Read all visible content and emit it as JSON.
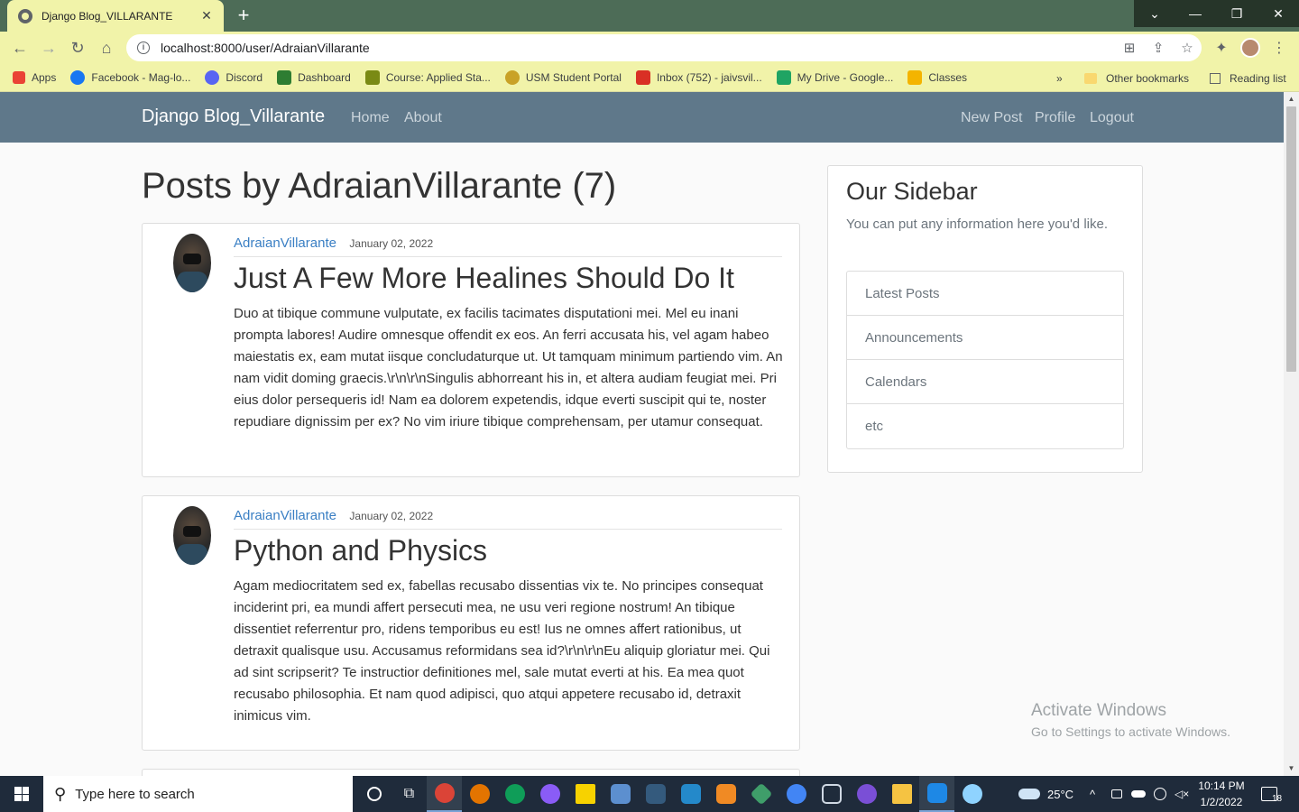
{
  "browser": {
    "tab_title": "Django Blog_VILLARANTE",
    "tab_close": "✕",
    "new_tab": "+",
    "url": "localhost:8000/user/AdraianVillarante",
    "window_buttons": [
      "⌄",
      "—",
      "❐",
      "✕"
    ]
  },
  "bookmarks": {
    "items": [
      {
        "label": "Apps",
        "color": "#ea4335"
      },
      {
        "label": "Facebook - Mag-lo...",
        "color": "#1877f2"
      },
      {
        "label": "Discord",
        "color": "#5865f2"
      },
      {
        "label": "Dashboard",
        "color": "#2e7d32"
      },
      {
        "label": "Course: Applied Sta...",
        "color": "#7a8a14"
      },
      {
        "label": "USM Student Portal",
        "color": "#c9a227"
      },
      {
        "label": "Inbox (752) - jaivsvil...",
        "color": "#d93025"
      },
      {
        "label": "My Drive - Google...",
        "color": "#1fa463"
      },
      {
        "label": "Classes",
        "color": "#f4b400"
      }
    ],
    "overflow": "»",
    "other": "Other bookmarks",
    "reading_list": "Reading list"
  },
  "site": {
    "brand": "Django Blog_Villarante",
    "nav_left": [
      "Home",
      "About"
    ],
    "nav_right": [
      "New Post",
      "Profile",
      "Logout"
    ]
  },
  "page_title": "Posts by AdraianVillarante (7)",
  "posts": [
    {
      "author": "AdraianVillarante",
      "date": "January 02, 2022",
      "title": "Just A Few More Healines Should Do It",
      "body": "Duo at tibique commune vulputate, ex facilis tacimates disputationi mei. Mel eu inani prompta labores! Audire omnesque offendit ex eos. An ferri accusata his, vel agam habeo maiestatis ex, eam mutat iisque concludaturque ut. Ut tamquam minimum partiendo vim. An nam vidit doming graecis.\\r\\n\\r\\nSingulis abhorreant his in, et altera audiam feugiat mei. Pri eius dolor persequeris id! Nam ea dolorem expetendis, idque everti suscipit qui te, noster repudiare dignissim per ex? No vim iriure tibique comprehensam, per utamur consequat."
    },
    {
      "author": "AdraianVillarante",
      "date": "January 02, 2022",
      "title": "Python and Physics",
      "body": "Agam mediocritatem sed ex, fabellas recusabo dissentias vix te. No principes consequat inciderint pri, ea mundi affert persecuti mea, ne usu veri regione nostrum! An tibique dissentiet referrentur pro, ridens temporibus eu est! Ius ne omnes affert rationibus, ut detraxit qualisque usu. Accusamus reformidans sea id?\\r\\n\\r\\nEu aliquip gloriatur mei. Qui ad sint scripserit? Te instructior definitiones mel, sale mutat everti at his. Ea mea quot recusabo philosophia. Et nam quod adipisci, quo atqui appetere recusabo id, detraxit inimicus vim."
    }
  ],
  "sidebar": {
    "title": "Our Sidebar",
    "lead": "You can put any information here you'd like.",
    "items": [
      "Latest Posts",
      "Announcements",
      "Calendars",
      "etc"
    ]
  },
  "watermark": {
    "line1": "Activate Windows",
    "line2": "Go to Settings to activate Windows."
  },
  "taskbar": {
    "search_placeholder": "Type here to search",
    "weather": "25°C",
    "time": "10:14 PM",
    "date": "1/2/2022",
    "notifications": "18",
    "tray_caret": "^"
  },
  "colors": {
    "navbar": "#5f788a",
    "link": "#3a7fc4",
    "chrome_tab": "#f1f3a9",
    "chrome_frame": "#4d6c57",
    "taskbar": "#1f2b3b"
  }
}
